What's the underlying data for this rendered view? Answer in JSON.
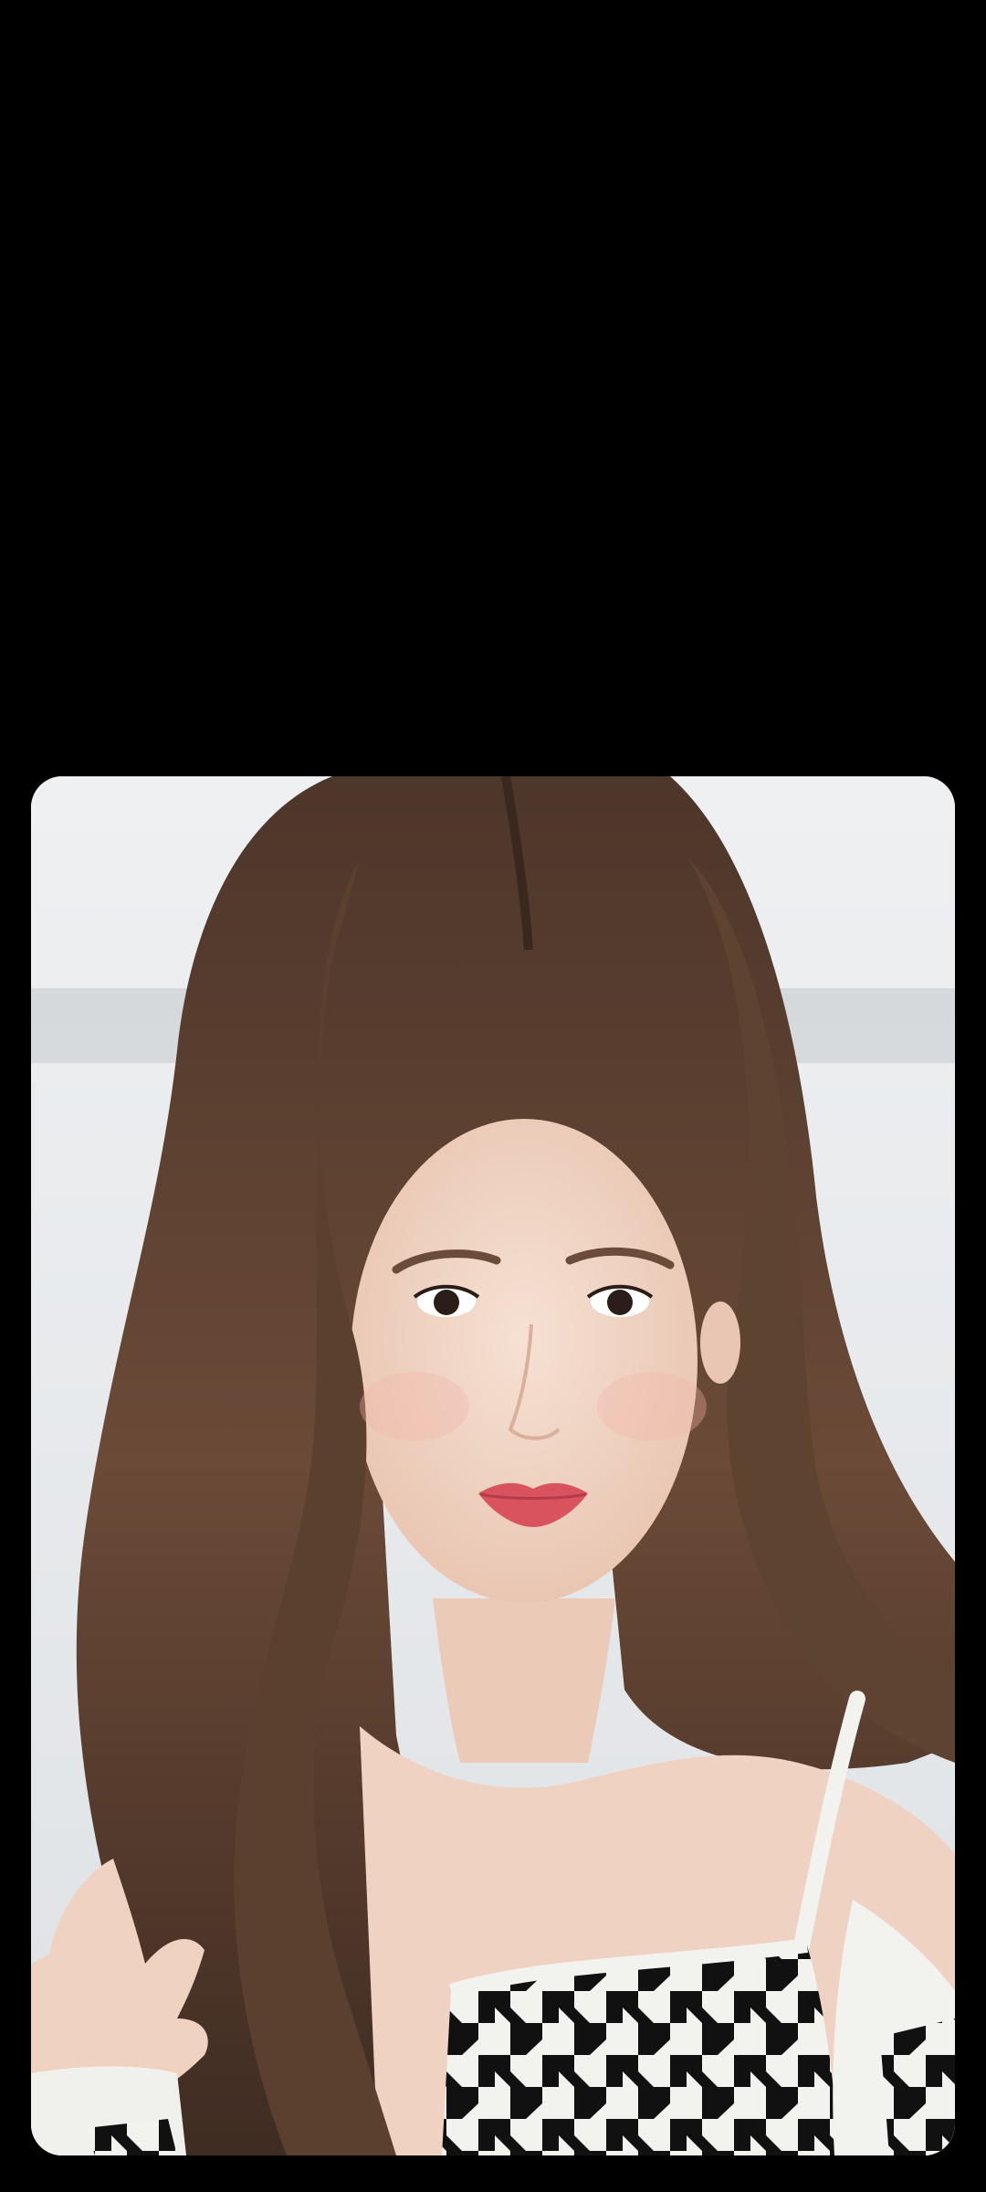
{
  "viewer": {
    "background_color": "#000000",
    "photo": {
      "subject": "portrait-photo",
      "wall_color": "#e8eaec",
      "hair_color": "#5a3f2f",
      "skin_color": "#f1d6c6",
      "lip_color": "#d8535d",
      "top_pattern": "houndstooth",
      "top_colors": [
        "#111111",
        "#f2f2ef"
      ]
    }
  }
}
